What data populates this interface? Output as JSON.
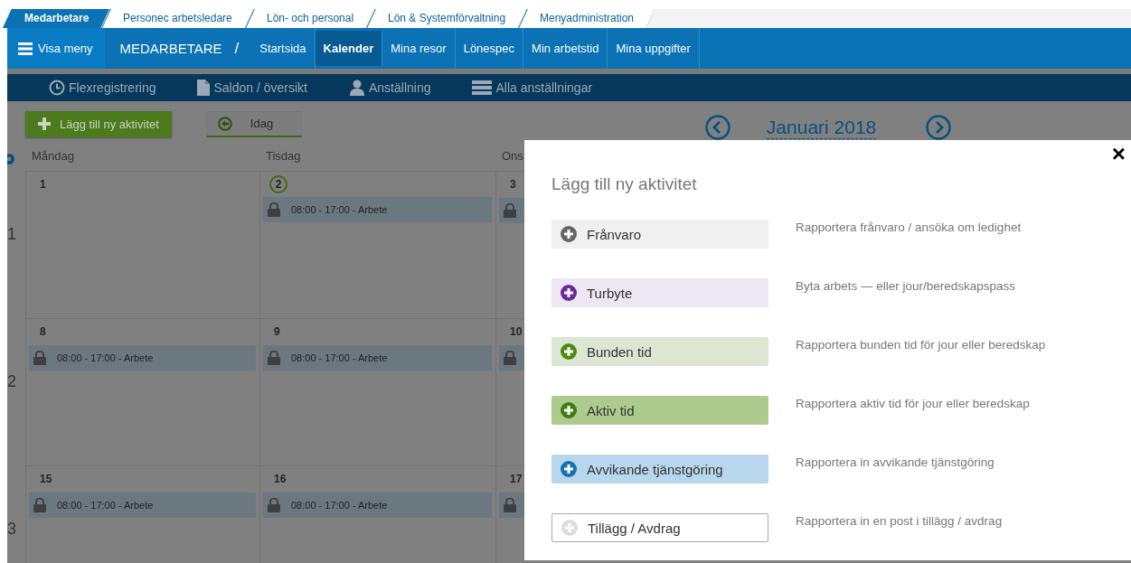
{
  "top_tabs": [
    {
      "label": "Medarbetare",
      "selected": true
    },
    {
      "label": "Personec arbetsledare",
      "selected": false
    },
    {
      "label": "Lön- och personal",
      "selected": false
    },
    {
      "label": "Lön & Systemförvaltning",
      "selected": false
    },
    {
      "label": "Menyadministration",
      "selected": false
    }
  ],
  "menu_button": "Visa meny",
  "section_title": "MEDARBETARE",
  "breadcrumb_separator": "/",
  "nav": [
    {
      "label": "Startsida",
      "selected": false
    },
    {
      "label": "Kalender",
      "selected": true
    },
    {
      "label": "Mina resor",
      "selected": false
    },
    {
      "label": "Lönespec",
      "selected": false
    },
    {
      "label": "Min arbetstid",
      "selected": false
    },
    {
      "label": "Mina uppgifter",
      "selected": false
    }
  ],
  "subnav": [
    {
      "label": "Flexregistrering",
      "kind": "clock"
    },
    {
      "label": "Saldon / översikt",
      "kind": "document"
    },
    {
      "label": "Anställning",
      "kind": "person"
    },
    {
      "label": "Alla anställningar",
      "kind": "list"
    }
  ],
  "add_button": "Lägg till ny aktivitet",
  "today_button": "Idag",
  "month": "Januari 2018",
  "calendar": {
    "days": [
      "Måndag",
      "Tisdag",
      "Ons"
    ],
    "week_numbers": [
      "1",
      "2",
      "3"
    ],
    "weeks": [
      {
        "cells": [
          {
            "date": "1",
            "today": false
          },
          {
            "date": "2",
            "today": true,
            "events": [
              {
                "label": "08:00 - 17:00 - Arbete",
                "locked": true
              }
            ]
          },
          {
            "date": "3",
            "today": false,
            "events": [
              {
                "locked": true
              }
            ]
          }
        ]
      },
      {
        "cells": [
          {
            "date": "8",
            "today": false,
            "events": [
              {
                "label": "08:00 - 17:00 - Arbete",
                "locked": true
              }
            ]
          },
          {
            "date": "9",
            "today": false,
            "events": [
              {
                "label": "08:00 - 17:00 - Arbete",
                "locked": true
              }
            ]
          },
          {
            "date": "10",
            "today": false,
            "events": [
              {
                "locked": true
              }
            ]
          }
        ]
      },
      {
        "cells": [
          {
            "date": "15",
            "today": false,
            "events": [
              {
                "label": "08:00 - 17:00 - Arbete",
                "locked": true
              }
            ]
          },
          {
            "date": "16",
            "today": false,
            "events": [
              {
                "label": "08:00 - 17:00 - Arbete",
                "locked": true
              }
            ]
          },
          {
            "date": "17",
            "today": false,
            "events": [
              {
                "locked": true
              }
            ]
          }
        ]
      }
    ]
  },
  "modal": {
    "title": "Lägg till ny aktivitet",
    "close": "×",
    "options": [
      {
        "label": "Frånvaro",
        "description": "Rapportera frånvaro / ansöka om ledighet",
        "kind": "grey",
        "color": "#666666"
      },
      {
        "label": "Turbyte",
        "description": "Byta arbets — eller jour/beredskapspass",
        "kind": "lilac",
        "color": "#6a2a9a"
      },
      {
        "label": "Bunden tid",
        "description": "Rapportera bunden tid för jour eller beredskap",
        "kind": "pale-green",
        "color": "#4a8a12"
      },
      {
        "label": "Aktiv tid",
        "description": "Rapportera aktiv tid för jour eller beredskap",
        "kind": "green",
        "color": "#3f7d10"
      },
      {
        "label": "Avvikande tjänstgöring",
        "description": "Rapportera in avvikande tjänstgöring",
        "kind": "blue",
        "color": "#1272b5"
      },
      {
        "label": "Tillägg / Avdrag",
        "description": "Rapportera in en post i tillägg / avdrag",
        "kind": "outline",
        "color": "#dddddd"
      }
    ]
  }
}
